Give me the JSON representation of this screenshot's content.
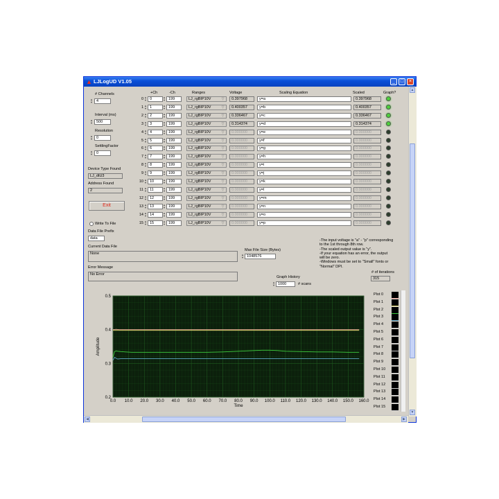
{
  "window": {
    "title": "LJLogUD V1.05",
    "min_label": "_",
    "max_label": "□",
    "close_label": "×",
    "title_icon": "▲"
  },
  "colors": {
    "led_on": "#4cd13a",
    "led_off": "#2c3d2c",
    "chart_bg": "#0c200c",
    "grid": "#1f5a1f"
  },
  "left_panel": {
    "num_channels_label": "# Channels",
    "num_channels_value": "4",
    "interval_label": "Interval (ms)",
    "interval_value": "500",
    "resolution_label": "Resolution",
    "resolution_value": "0",
    "settling_label": "SettlingFactor",
    "settling_value": "0",
    "device_type_label": "Device Type Found",
    "device_type_value": "LJ_dtU3",
    "address_label": "Address Found",
    "address_value": "2",
    "exit_label": "Exit",
    "write_to_file_label": "Write To File",
    "prefix_label": "Data File Prefix",
    "prefix_value": "data",
    "current_file_label": "Current Data File",
    "current_file_value": "None",
    "error_label": "Error Message",
    "error_value": "No Error"
  },
  "table": {
    "headers": {
      "pos": "+Ch",
      "neg": "-Ch",
      "range": "Ranges",
      "voltage": "Voltage",
      "equation": "Scaling Equation",
      "scaled": "Scaled",
      "graph": "Graph?"
    },
    "rows": [
      {
        "idx": "0",
        "pos": "0",
        "neg": "199",
        "range": "LJ_rgBIP10V",
        "voltage": "0.397968",
        "eq": "y=a",
        "scaled": "0.397968",
        "on": true
      },
      {
        "idx": "1",
        "pos": "1",
        "neg": "199",
        "range": "LJ_rgBIP10V",
        "voltage": "0.400357",
        "eq": "y=b",
        "scaled": "0.400357",
        "on": true
      },
      {
        "idx": "2",
        "pos": "2",
        "neg": "199",
        "range": "LJ_rgBIP10V",
        "voltage": "0.336467",
        "eq": "y=c",
        "scaled": "0.336467",
        "on": true
      },
      {
        "idx": "3",
        "pos": "3",
        "neg": "199",
        "range": "LJ_rgBIP10V",
        "voltage": "0.314374",
        "eq": "y=d",
        "scaled": "0.314374",
        "on": true
      },
      {
        "idx": "4",
        "pos": "4",
        "neg": "199",
        "range": "LJ_rgBIP10V",
        "voltage": "0.000000",
        "eq": "y=e",
        "scaled": "0.000000",
        "on": false
      },
      {
        "idx": "5",
        "pos": "5",
        "neg": "199",
        "range": "LJ_rgBIP10V",
        "voltage": "0.000000",
        "eq": "y=f",
        "scaled": "0.000000",
        "on": false
      },
      {
        "idx": "6",
        "pos": "6",
        "neg": "199",
        "range": "LJ_rgBIP10V",
        "voltage": "0.000000",
        "eq": "y=g",
        "scaled": "0.000000",
        "on": false
      },
      {
        "idx": "7",
        "pos": "7",
        "neg": "199",
        "range": "LJ_rgBIP10V",
        "voltage": "0.000000",
        "eq": "y=h",
        "scaled": "0.000000",
        "on": false
      },
      {
        "idx": "8",
        "pos": "8",
        "neg": "199",
        "range": "LJ_rgBIP10V",
        "voltage": "0.000000",
        "eq": "y=i",
        "scaled": "0.000000",
        "on": false
      },
      {
        "idx": "9",
        "pos": "9",
        "neg": "199",
        "range": "LJ_rgBIP10V",
        "voltage": "0.000000",
        "eq": "y=j",
        "scaled": "0.000000",
        "on": false
      },
      {
        "idx": "10",
        "pos": "10",
        "neg": "199",
        "range": "LJ_rgBIP10V",
        "voltage": "0.000000",
        "eq": "y=k",
        "scaled": "0.000000",
        "on": false
      },
      {
        "idx": "11",
        "pos": "11",
        "neg": "199",
        "range": "LJ_rgBIP10V",
        "voltage": "0.000000",
        "eq": "y=l",
        "scaled": "0.000000",
        "on": false
      },
      {
        "idx": "12",
        "pos": "12",
        "neg": "199",
        "range": "LJ_rgBIP10V",
        "voltage": "0.000000",
        "eq": "y=m",
        "scaled": "0.000000",
        "on": false
      },
      {
        "idx": "13",
        "pos": "13",
        "neg": "199",
        "range": "LJ_rgBIP10V",
        "voltage": "0.000000",
        "eq": "y=n",
        "scaled": "0.000000",
        "on": false
      },
      {
        "idx": "14",
        "pos": "14",
        "neg": "199",
        "range": "LJ_rgBIP10V",
        "voltage": "0.000000",
        "eq": "y=o",
        "scaled": "0.000000",
        "on": false
      },
      {
        "idx": "15",
        "pos": "15",
        "neg": "199",
        "range": "LJ_rgBIP10V",
        "voltage": "0.000000",
        "eq": "y=p",
        "scaled": "0.000000",
        "on": false
      }
    ]
  },
  "max_file": {
    "label": "Max File Size (Bytes)",
    "value": "1048576"
  },
  "notes": [
    "-The input voltage is \"a\" - \"p\" corresponding",
    "  to the 1st through 8th row.",
    "-The scaled output value is \"y\".",
    "-If your equation has an error, the output",
    "  will be zero.",
    "-Windows must be set to \"Small\" fonts or",
    "  \"Normal\" DPI."
  ],
  "iterations": {
    "label": "# of iterations",
    "value": "315"
  },
  "graph_history": {
    "label": "Graph History",
    "value": "1000",
    "unit": "# scans"
  },
  "legend": [
    "Plot 0",
    "Plot 1",
    "Plot 2",
    "Plot 3",
    "Plot 4",
    "Plot 5",
    "Plot 6",
    "Plot 7",
    "Plot 8",
    "Plot 9",
    "Plot 10",
    "Plot 11",
    "Plot 12",
    "Plot 13",
    "Plot 14",
    "Plot 15"
  ],
  "chart_data": {
    "type": "line",
    "xlabel": "Time",
    "ylabel": "Amplitude",
    "xlim": [
      0,
      160
    ],
    "ylim": [
      0.2,
      0.5
    ],
    "xticks": [
      "0.0",
      "10.0",
      "20.0",
      "30.0",
      "40.0",
      "50.0",
      "60.0",
      "70.0",
      "80.0",
      "90.0",
      "100.0",
      "110.0",
      "120.0",
      "130.0",
      "140.0",
      "150.0",
      "160.0"
    ],
    "yticks": [
      "0.2",
      "0.3",
      "0.4",
      "0.5"
    ],
    "grid": true,
    "series": [
      {
        "color": "#f2a8a0",
        "x": [
          0,
          2,
          4,
          10,
          40,
          80,
          120,
          157
        ],
        "y": [
          0.4,
          0.401,
          0.4,
          0.4,
          0.4,
          0.4,
          0.4,
          0.4
        ]
      },
      {
        "color": "#e8e070",
        "x": [
          0,
          2,
          4,
          10,
          40,
          80,
          120,
          157
        ],
        "y": [
          0.398,
          0.398,
          0.398,
          0.398,
          0.398,
          0.398,
          0.398,
          0.398
        ]
      },
      {
        "color": "#3fcf3f",
        "x": [
          0,
          1,
          2,
          3,
          5,
          8,
          12,
          20,
          30,
          40,
          50,
          60,
          70,
          80,
          90,
          95,
          100,
          105,
          110,
          120,
          130,
          140,
          150,
          157
        ],
        "y": [
          0.318,
          0.335,
          0.337,
          0.336,
          0.335,
          0.334,
          0.333,
          0.333,
          0.333,
          0.333,
          0.333,
          0.333,
          0.334,
          0.336,
          0.338,
          0.339,
          0.339,
          0.338,
          0.336,
          0.335,
          0.334,
          0.334,
          0.333,
          0.333
        ]
      },
      {
        "color": "#5fa8c8",
        "x": [
          0,
          1,
          2,
          3,
          5,
          8,
          12,
          20,
          30,
          40,
          60,
          80,
          100,
          120,
          140,
          157
        ],
        "y": [
          0.309,
          0.318,
          0.315,
          0.313,
          0.314,
          0.314,
          0.314,
          0.314,
          0.314,
          0.314,
          0.314,
          0.314,
          0.314,
          0.314,
          0.314,
          0.314
        ]
      }
    ]
  }
}
